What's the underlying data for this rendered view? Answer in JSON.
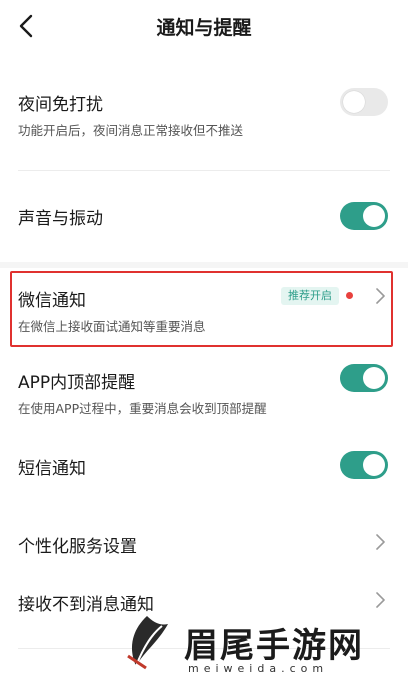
{
  "header": {
    "title": "通知与提醒"
  },
  "settings": {
    "night_dnd": {
      "title": "夜间免打扰",
      "subtitle": "功能开启后，夜间消息正常接收但不推送",
      "enabled": false
    },
    "sound_vibration": {
      "title": "声音与振动",
      "enabled": true
    },
    "wechat_notify": {
      "title": "微信通知",
      "badge": "推荐开启",
      "subtitle": "在微信上接收面试通知等重要消息"
    },
    "app_top_alert": {
      "title": "APP内顶部提醒",
      "subtitle": "在使用APP过程中，重要消息会收到顶部提醒",
      "enabled": true
    },
    "sms_notify": {
      "title": "短信通知",
      "enabled": true
    },
    "personalized": {
      "title": "个性化服务设置"
    },
    "no_messages": {
      "title": "接收不到消息通知"
    }
  },
  "watermark": {
    "brand": "眉尾手游网",
    "domain": "meiweida.com"
  },
  "colors": {
    "accent": "#2e9e8a",
    "highlight": "#e0312f",
    "dot": "#e8413e"
  }
}
